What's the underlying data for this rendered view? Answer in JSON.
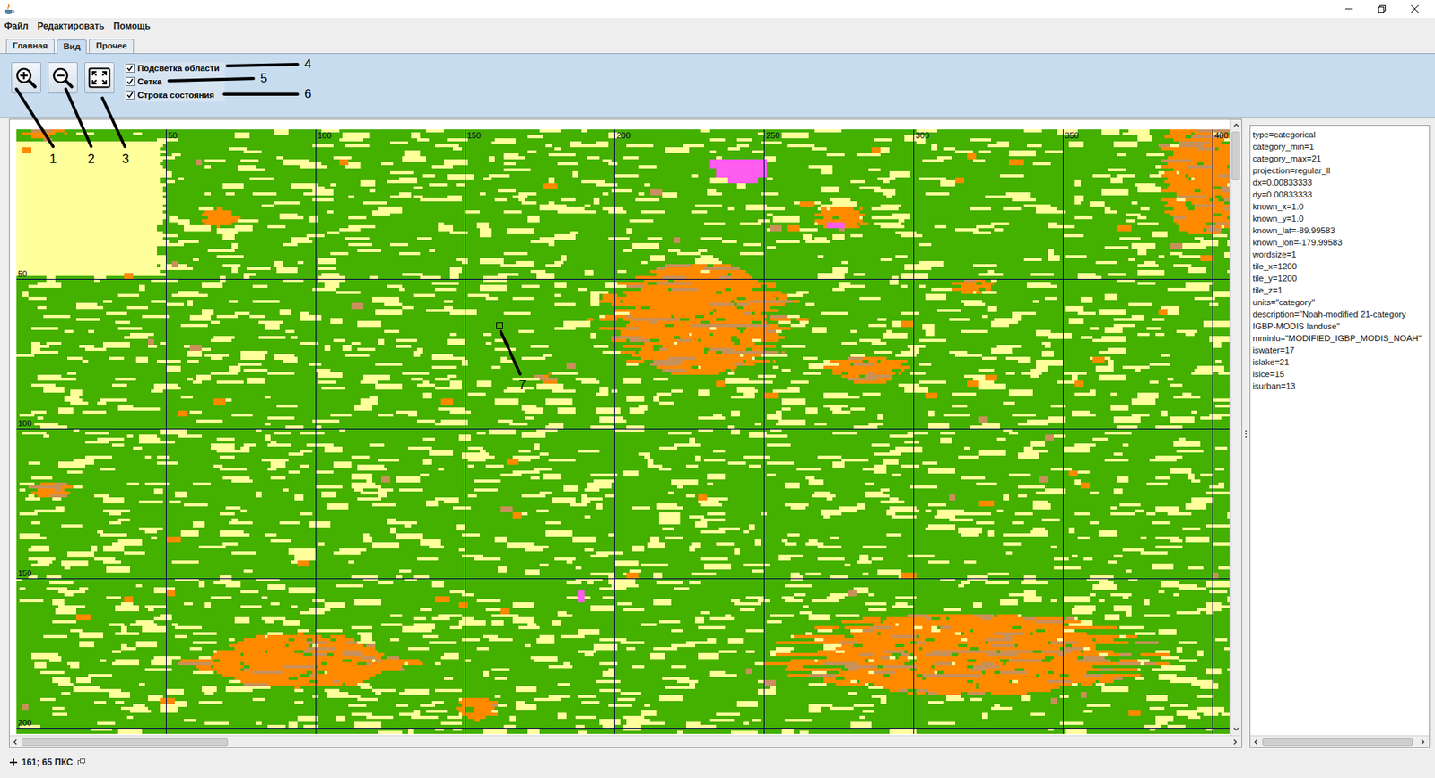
{
  "menu": [
    {
      "label": "Файл"
    },
    {
      "label": "Редактировать"
    },
    {
      "label": "Помощь"
    }
  ],
  "tabs": [
    {
      "label": "Главная",
      "selected": false
    },
    {
      "label": "Вид",
      "selected": true
    },
    {
      "label": "Прочее",
      "selected": false
    }
  ],
  "options": [
    {
      "label": "Подсветка области",
      "checked": true
    },
    {
      "label": "Сетка",
      "checked": true
    },
    {
      "label": "Строка состояния",
      "checked": true
    }
  ],
  "annotations": [
    {
      "label": "1"
    },
    {
      "label": "2"
    },
    {
      "label": "3"
    },
    {
      "label": "4"
    },
    {
      "label": "5"
    },
    {
      "label": "6"
    },
    {
      "label": "7"
    }
  ],
  "map": {
    "x_labels": [
      "50",
      "100",
      "150",
      "200",
      "250",
      "300",
      "350",
      "400"
    ],
    "y_labels": [
      "50",
      "100",
      "150",
      "200"
    ],
    "land_classes": [
      {
        "kind": "base",
        "color": "#44b000"
      },
      {
        "kind": "streak",
        "color": "#ffff9c"
      },
      {
        "kind": "patch",
        "color": "#ff8a00"
      },
      {
        "kind": "speckle",
        "color": "#c8905a"
      },
      {
        "kind": "spot",
        "color": "#ff5cf0"
      }
    ],
    "scroll": {
      "horizontal": {
        "offset": 0,
        "level": 0.17
      },
      "vertical": {
        "offset": 0,
        "level": 0.08
      }
    }
  },
  "info": {
    "lines": [
      "type=categorical",
      "category_min=1",
      "category_max=21",
      "projection=regular_ll",
      "dx=0.00833333",
      "dy=0.00833333",
      "known_x=1.0",
      "known_y=1.0",
      "known_lat=-89.99583",
      "known_lon=-179.99583",
      "wordsize=1",
      "tile_x=1200",
      "tile_y=1200",
      "tile_z=1",
      "units=\"category\"",
      "description=\"Noah-modified 21-category",
      "IGBP-MODIS landuse\"",
      "mminlu=\"MODIFIED_IGBP_MODIS_NOAH\"",
      "iswater=17",
      "islake=21",
      "isice=15",
      "isurban=13"
    ],
    "scroll": {
      "offset": 0,
      "level": 0.97
    }
  },
  "status_bar": {
    "text": "161; 65 ПКС"
  }
}
